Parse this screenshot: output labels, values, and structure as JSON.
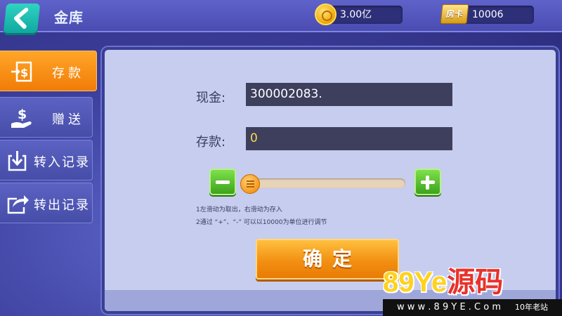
{
  "header": {
    "title": "金库",
    "gold_value": "3.00亿",
    "room_card_label": "房卡",
    "room_card_value": "10006"
  },
  "sidebar": {
    "items": [
      {
        "label": "存款",
        "icon": "deposit-icon",
        "active": true
      },
      {
        "label": "赠送",
        "icon": "dollar-hand-icon",
        "active": false
      },
      {
        "label": "转入记录",
        "icon": "download-icon",
        "active": false
      },
      {
        "label": "转出记录",
        "icon": "share-icon",
        "active": false
      }
    ]
  },
  "form": {
    "cash_label": "现金:",
    "cash_value": "300002083.",
    "deposit_label": "存款:",
    "deposit_value": "0",
    "slider_value": 0,
    "hint_1": "1左滑动为取出，右滑动为存入",
    "hint_2": "2通过 “+”、“-” 可以以10000为单位进行调节",
    "confirm_label": "确定"
  },
  "watermark": {
    "brand_digits": "89",
    "brand_latin": "Ye",
    "brand_cn": "源码",
    "url": "w w w . 8 9 Y E . C o m",
    "tagline": "10年老站"
  },
  "colors": {
    "accent_orange": "#f17c07",
    "accent_green": "#3ca31b",
    "panel_bg": "#c6cdee",
    "teal_back": "#10a99f"
  }
}
